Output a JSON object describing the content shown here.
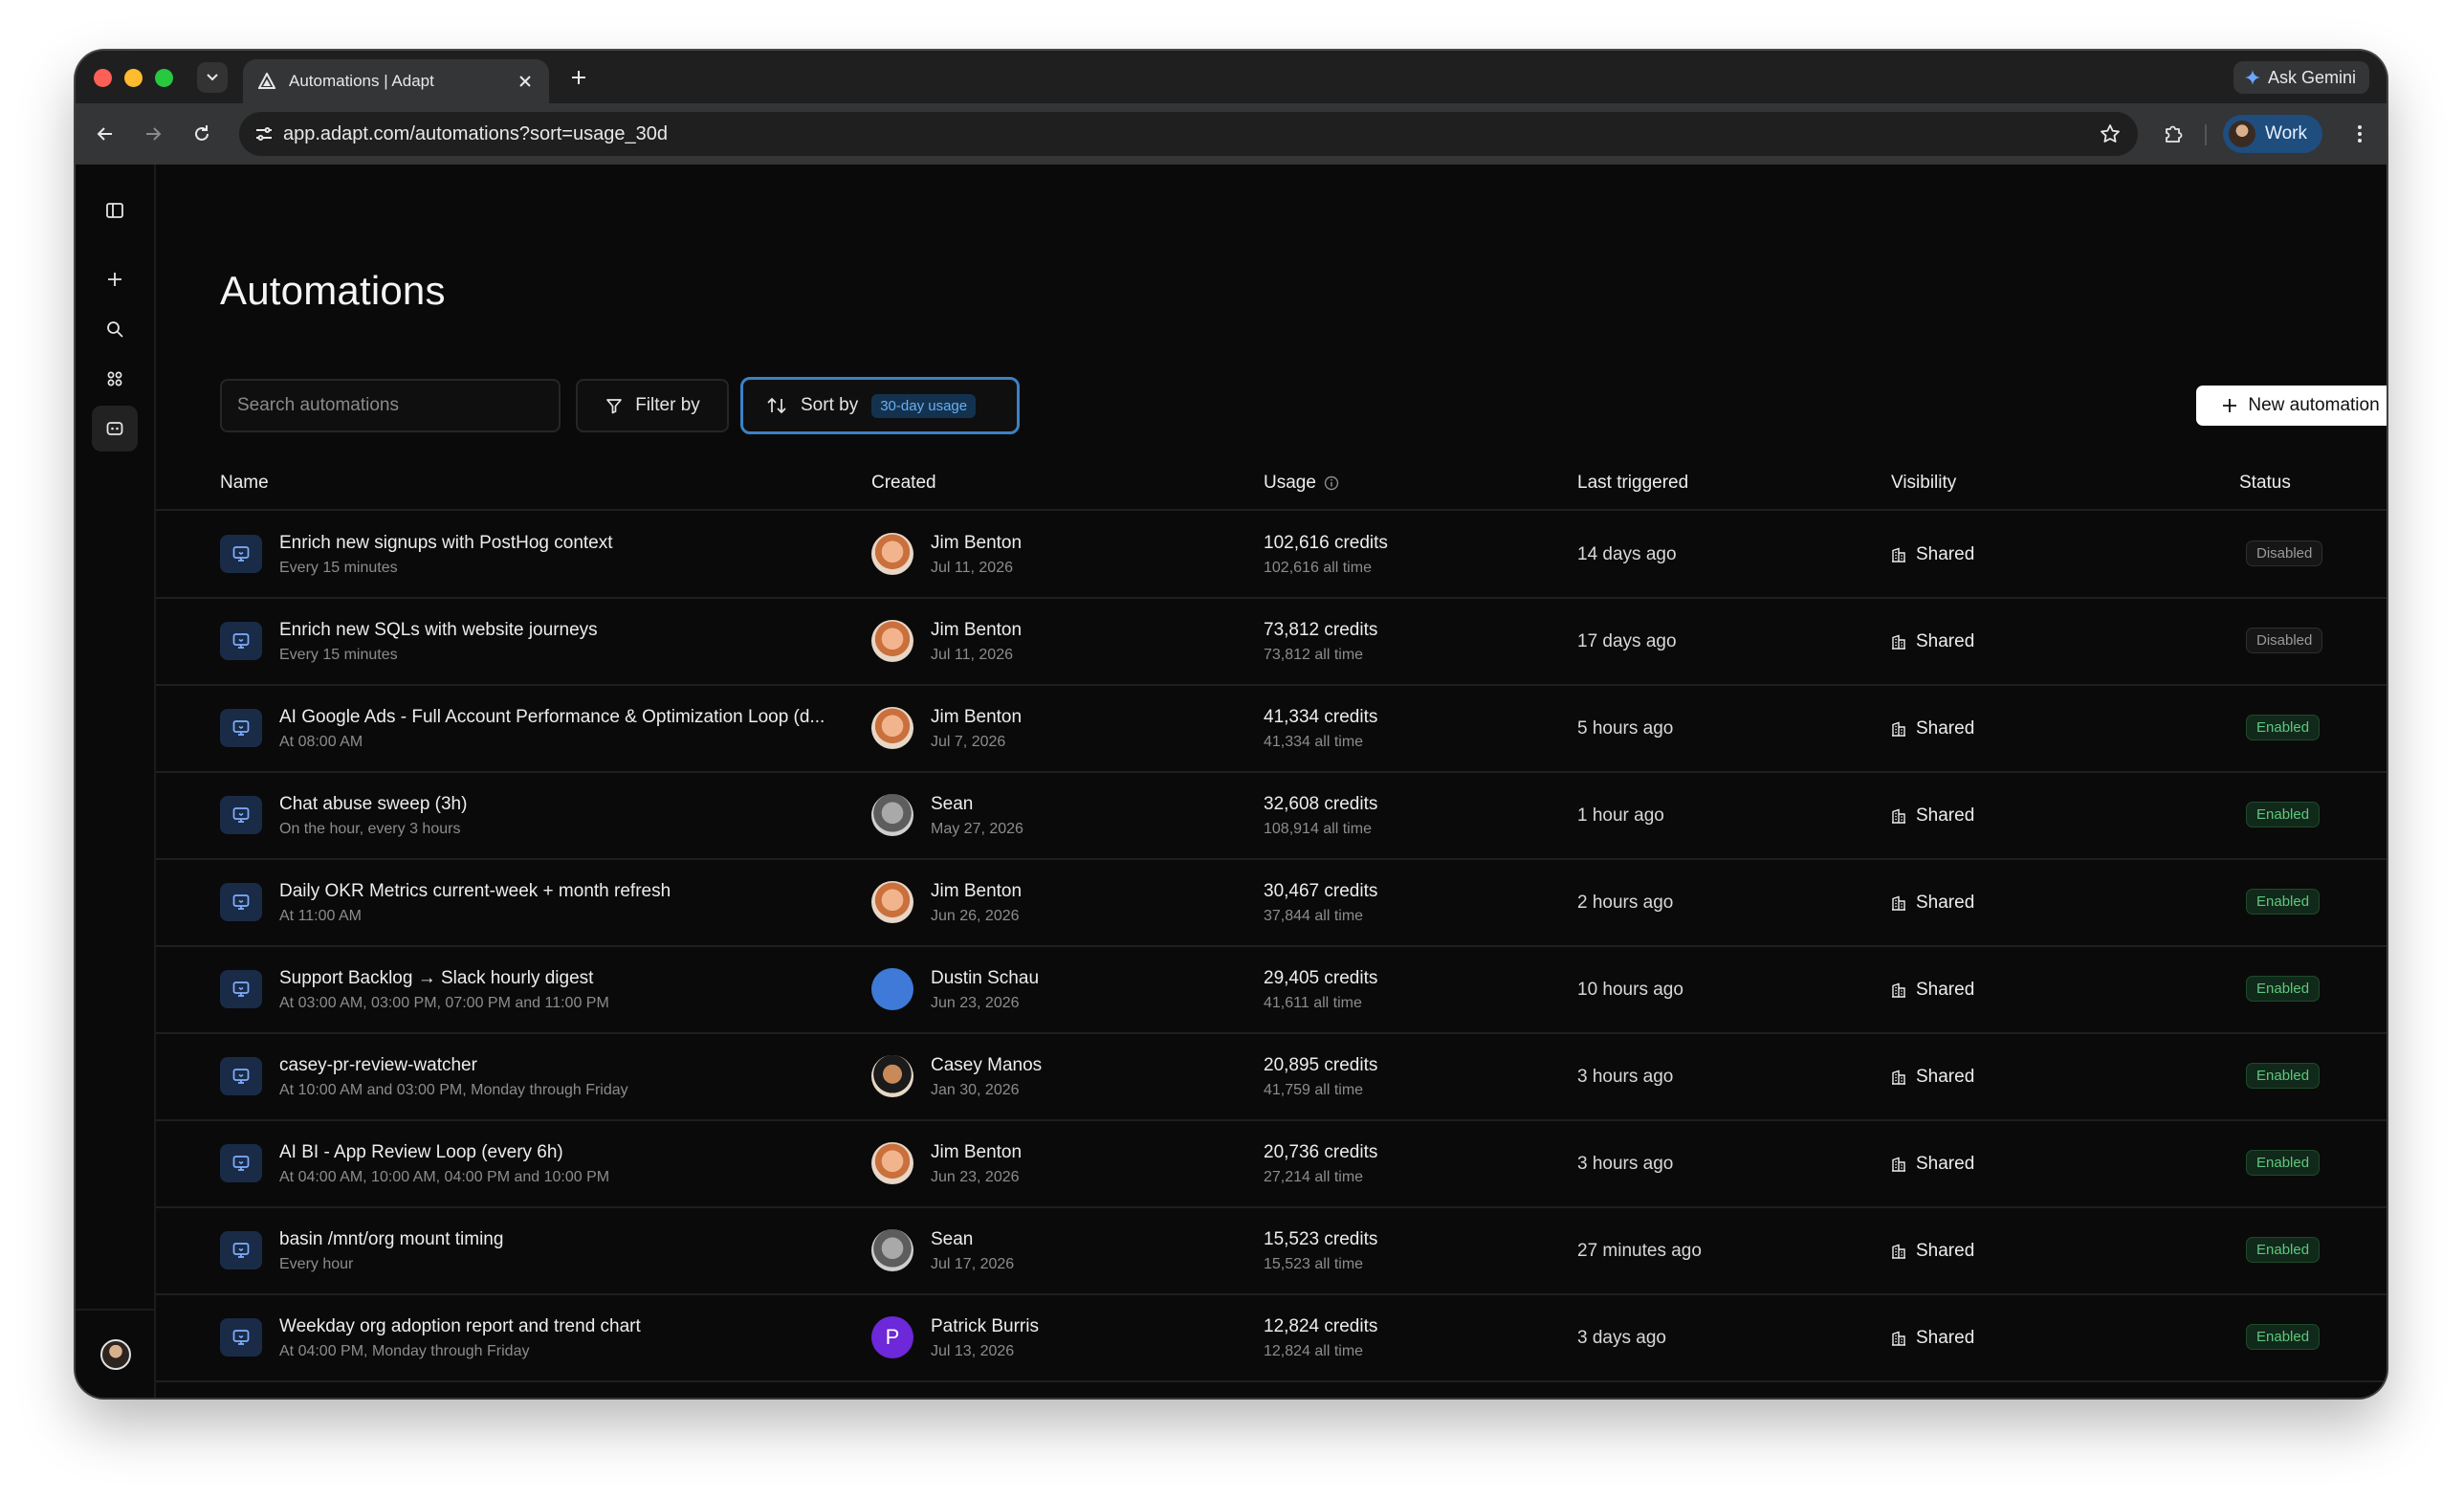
{
  "browser": {
    "tab_title": "Automations | Adapt",
    "ask_gemini": "Ask Gemini",
    "url": "app.adapt.com/automations?sort=usage_30d",
    "profile": "Work"
  },
  "page": {
    "title": "Automations",
    "search_placeholder": "Search automations",
    "filter_label": "Filter by",
    "sort_label": "Sort by",
    "sort_value": "30-day usage",
    "new_button": "New automation"
  },
  "table": {
    "columns": {
      "name": "Name",
      "created": "Created",
      "usage": "Usage",
      "last_triggered": "Last triggered",
      "visibility": "Visibility",
      "status": "Status"
    },
    "rows": [
      {
        "name": "Enrich new signups with PostHog context",
        "schedule": "Every 15 minutes",
        "creator": "Jim Benton",
        "created": "Jul 11, 2026",
        "avatar": "jim",
        "credits": "102,616 credits",
        "all_time": "102,616 all time",
        "last": "14 days ago",
        "visibility": "Shared",
        "status": "Disabled"
      },
      {
        "name": "Enrich new SQLs with website journeys",
        "schedule": "Every 15 minutes",
        "creator": "Jim Benton",
        "created": "Jul 11, 2026",
        "avatar": "jim",
        "credits": "73,812 credits",
        "all_time": "73,812 all time",
        "last": "17 days ago",
        "visibility": "Shared",
        "status": "Disabled"
      },
      {
        "name": "AI Google Ads - Full Account Performance & Optimization Loop (d...",
        "schedule": "At 08:00 AM",
        "creator": "Jim Benton",
        "created": "Jul 7, 2026",
        "avatar": "jim",
        "credits": "41,334 credits",
        "all_time": "41,334 all time",
        "last": "5 hours ago",
        "visibility": "Shared",
        "status": "Enabled"
      },
      {
        "name": "Chat abuse sweep (3h)",
        "schedule": "On the hour, every 3 hours",
        "creator": "Sean",
        "created": "May 27, 2026",
        "avatar": "sean",
        "credits": "32,608 credits",
        "all_time": "108,914 all time",
        "last": "1 hour ago",
        "visibility": "Shared",
        "status": "Enabled"
      },
      {
        "name": "Daily OKR Metrics current-week + month refresh",
        "schedule": "At 11:00 AM",
        "creator": "Jim Benton",
        "created": "Jun 26, 2026",
        "avatar": "jim",
        "credits": "30,467 credits",
        "all_time": "37,844 all time",
        "last": "2 hours ago",
        "visibility": "Shared",
        "status": "Enabled"
      },
      {
        "name": "Support Backlog → Slack hourly digest",
        "schedule": "At 03:00 AM, 03:00 PM, 07:00 PM and 11:00 PM",
        "creator": "Dustin Schau",
        "created": "Jun 23, 2026",
        "avatar": "dustin",
        "credits": "29,405 credits",
        "all_time": "41,611 all time",
        "last": "10 hours ago",
        "visibility": "Shared",
        "status": "Enabled"
      },
      {
        "name": "casey-pr-review-watcher",
        "schedule": "At 10:00 AM and 03:00 PM, Monday through Friday",
        "creator": "Casey Manos",
        "created": "Jan 30, 2026",
        "avatar": "casey",
        "credits": "20,895 credits",
        "all_time": "41,759 all time",
        "last": "3 hours ago",
        "visibility": "Shared",
        "status": "Enabled"
      },
      {
        "name": "AI BI - App Review Loop (every 6h)",
        "schedule": "At 04:00 AM, 10:00 AM, 04:00 PM and 10:00 PM",
        "creator": "Jim Benton",
        "created": "Jun 23, 2026",
        "avatar": "jim",
        "credits": "20,736 credits",
        "all_time": "27,214 all time",
        "last": "3 hours ago",
        "visibility": "Shared",
        "status": "Enabled"
      },
      {
        "name": "basin /mnt/org mount timing",
        "schedule": "Every hour",
        "creator": "Sean",
        "created": "Jul 17, 2026",
        "avatar": "sean",
        "credits": "15,523 credits",
        "all_time": "15,523 all time",
        "last": "27 minutes ago",
        "visibility": "Shared",
        "status": "Enabled"
      },
      {
        "name": "Weekday org adoption report and trend chart",
        "schedule": "At 04:00 PM, Monday through Friday",
        "creator": "Patrick Burris",
        "created": "Jul 13, 2026",
        "avatar": "patrick",
        "avatar_letter": "P",
        "credits": "12,824 credits",
        "all_time": "12,824 all time",
        "last": "3 days ago",
        "visibility": "Shared",
        "status": "Enabled"
      }
    ]
  }
}
